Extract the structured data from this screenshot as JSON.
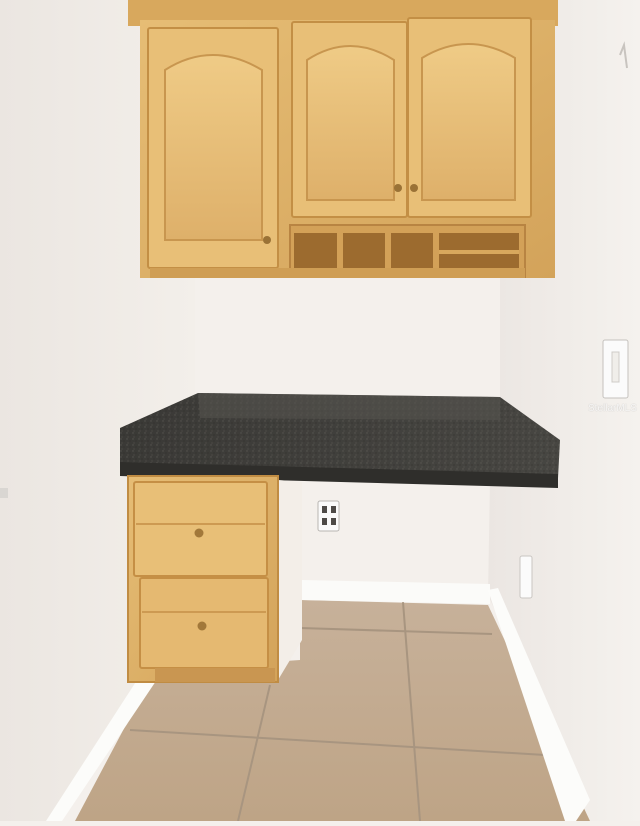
{
  "photo": {
    "subject": "built-in-desk-nook",
    "watermark_text": "StellarMLS",
    "colors": {
      "wall": "#f1ede9",
      "cabinet_wood": "#dcae63",
      "countertop": "#3b3b38",
      "floor_tile": "#c8b095",
      "baseboard": "#fbfbf9"
    }
  }
}
